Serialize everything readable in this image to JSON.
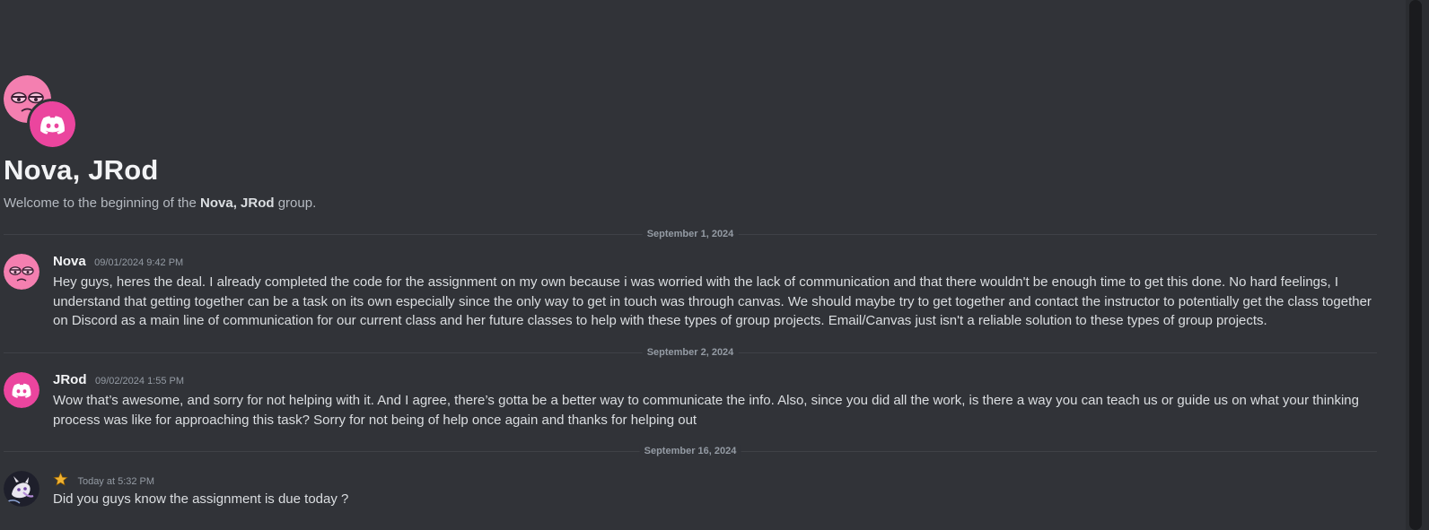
{
  "group": {
    "title": "Nova, JRod",
    "welcome_prefix": "Welcome to the beginning of the ",
    "welcome_name": "Nova, JRod",
    "welcome_suffix": " group."
  },
  "dividers": [
    {
      "label": "September 1, 2024"
    },
    {
      "label": "September 2, 2024"
    },
    {
      "label": "September 16, 2024"
    }
  ],
  "messages": [
    {
      "author": "Nova",
      "timestamp": "09/01/2024 9:42 PM",
      "avatar_icon": "nova-pink-face-avatar",
      "text": "Hey guys, heres the deal. I already completed the code for the assignment on my own because i was worried with the lack of communication and that there wouldn't be enough time to get this done. No hard feelings, I understand that getting together can be a task on its own especially since the only way to get in touch was through canvas. We should maybe try to get together and contact the instructor to potentially get the class together on Discord as a main line of communication for our current class and her future classes to help with these types of group projects. Email/Canvas just isn't a reliable solution to these types of group projects."
    },
    {
      "author": "JRod",
      "timestamp": "09/02/2024 1:55 PM",
      "avatar_icon": "discord-default-avatar",
      "text": "Wow that’s awesome, and sorry for not helping with it. And I agree, there’s gotta be a better way to communicate the info. Also, since you did all the work, is there a way you can teach us or guide us on what your thinking process was like for approaching this task? Sorry for not being of help once again and thanks for helping out"
    },
    {
      "author": "",
      "author_badge_icon": "star-icon",
      "timestamp": "Today at 5:32 PM",
      "avatar_icon": "mewtwo-avatar",
      "text": "Did you guys know the assignment is due today ?"
    }
  ],
  "colors": {
    "background": "#313338",
    "nova_pink": "#f47fb0",
    "discord_pink": "#eb459e",
    "text": "#dbdee1",
    "muted": "#949ba4"
  }
}
